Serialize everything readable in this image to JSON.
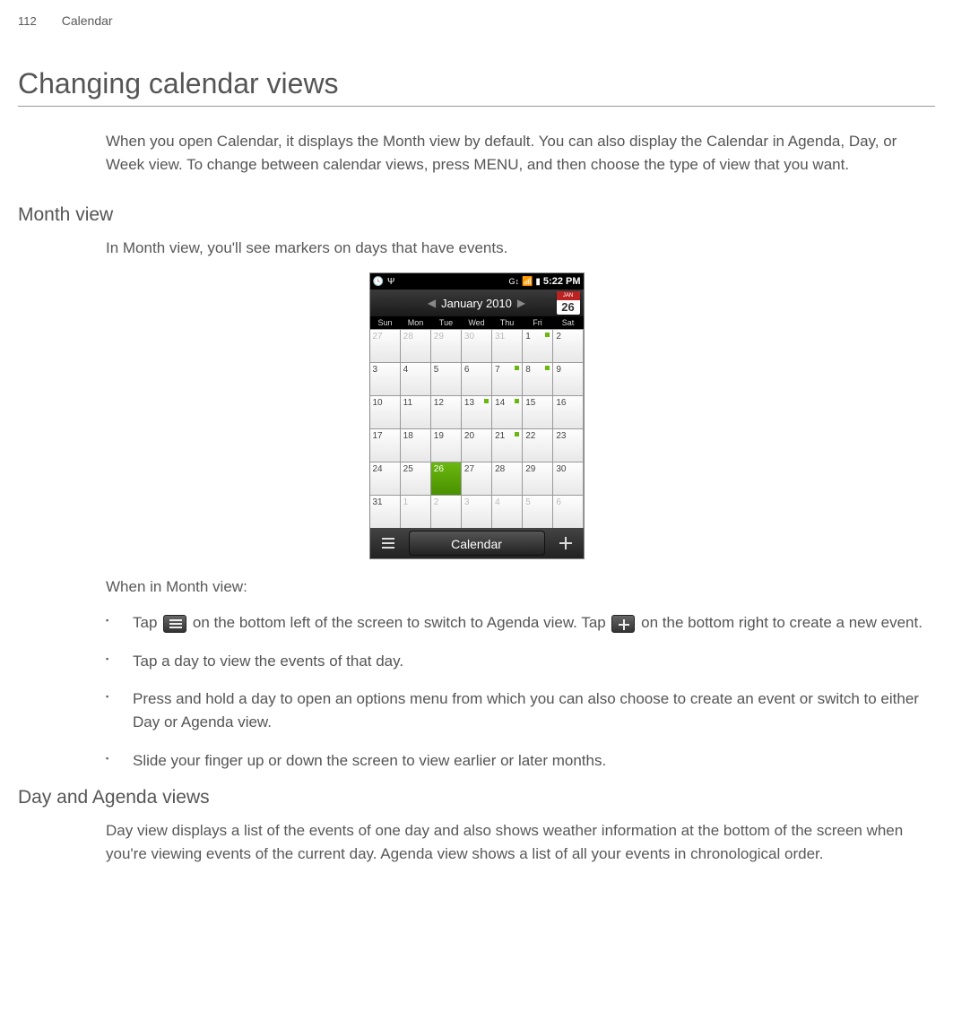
{
  "header": {
    "page_num": "112",
    "chapter": "Calendar"
  },
  "title": "Changing calendar views",
  "intro": "When you open Calendar, it displays the Month view by default. You can also display the Calendar in Agenda, Day, or Week view. To change between calendar views, press MENU, and then choose the type of view that you want.",
  "month_view": {
    "heading": "Month view",
    "desc": "In Month view, you'll see markers on days that have events.",
    "when_label": "When in Month view:",
    "bullets": {
      "b1_pre": "Tap ",
      "b1_mid": " on the bottom left of the screen to switch to Agenda view. Tap ",
      "b1_post": " on the bottom right to create a new event.",
      "b2": "Tap a day to view the events of that day.",
      "b3": "Press and hold a day to open an options menu from which you can also choose to create an event or switch to either Day or Agenda view.",
      "b4": "Slide your finger up or down the screen to view earlier or later months."
    }
  },
  "day_agenda": {
    "heading": "Day and Agenda views",
    "desc": "Day view displays a list of the events of one day and also shows weather information at the bottom of the screen when you're viewing events of the current day. Agenda view shows a list of all your events in chronological order."
  },
  "screenshot": {
    "status_time": "5:22 PM",
    "month_title": "January 2010",
    "badge_month": "JAN",
    "badge_day": "26",
    "dow": [
      "Sun",
      "Mon",
      "Tue",
      "Wed",
      "Thu",
      "Fri",
      "Sat"
    ],
    "grid": [
      {
        "n": "27",
        "dim": true
      },
      {
        "n": "28",
        "dim": true
      },
      {
        "n": "29",
        "dim": true
      },
      {
        "n": "30",
        "dim": true
      },
      {
        "n": "31",
        "dim": true
      },
      {
        "n": "1",
        "ev": true
      },
      {
        "n": "2"
      },
      {
        "n": "3"
      },
      {
        "n": "4"
      },
      {
        "n": "5"
      },
      {
        "n": "6"
      },
      {
        "n": "7",
        "ev": true
      },
      {
        "n": "8",
        "ev": true
      },
      {
        "n": "9"
      },
      {
        "n": "10"
      },
      {
        "n": "11"
      },
      {
        "n": "12"
      },
      {
        "n": "13",
        "ev": true
      },
      {
        "n": "14",
        "ev": true
      },
      {
        "n": "15"
      },
      {
        "n": "16"
      },
      {
        "n": "17"
      },
      {
        "n": "18"
      },
      {
        "n": "19"
      },
      {
        "n": "20"
      },
      {
        "n": "21",
        "ev": true
      },
      {
        "n": "22"
      },
      {
        "n": "23"
      },
      {
        "n": "24"
      },
      {
        "n": "25"
      },
      {
        "n": "26",
        "today": true
      },
      {
        "n": "27"
      },
      {
        "n": "28"
      },
      {
        "n": "29"
      },
      {
        "n": "30"
      },
      {
        "n": "31"
      },
      {
        "n": "1",
        "dim": true
      },
      {
        "n": "2",
        "dim": true
      },
      {
        "n": "3",
        "dim": true
      },
      {
        "n": "4",
        "dim": true
      },
      {
        "n": "5",
        "dim": true
      },
      {
        "n": "6",
        "dim": true
      }
    ],
    "bottom_label": "Calendar"
  }
}
